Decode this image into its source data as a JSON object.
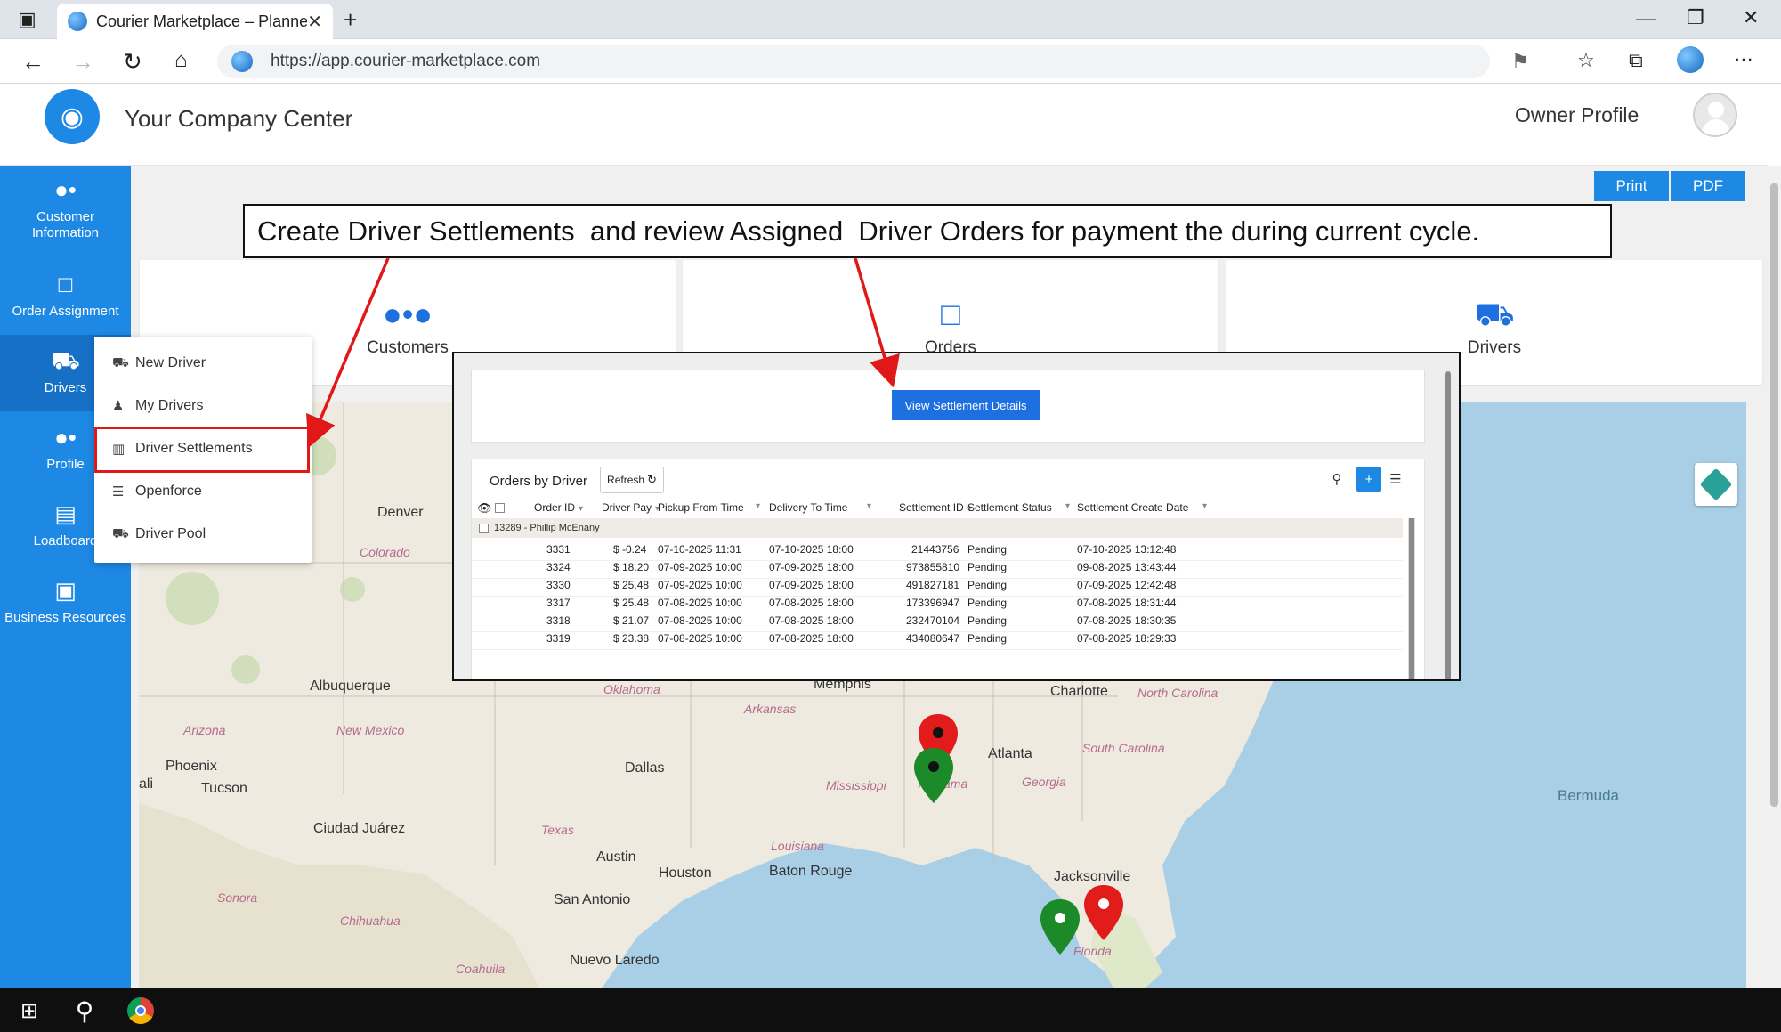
{
  "browser": {
    "tab_title": "Courier Marketplace – Planner",
    "url": "https://app.courier-marketplace.com"
  },
  "header": {
    "company": "Your Company Center",
    "owner": "Owner Profile"
  },
  "sidebar": {
    "items": [
      {
        "label": "Customer Information",
        "icon": "users-icon"
      },
      {
        "label": "Order Assignment",
        "icon": "monitor-icon"
      },
      {
        "label": "Drivers",
        "icon": "car-icon"
      },
      {
        "label": "Profile",
        "icon": "users-icon"
      },
      {
        "label": "Loadboard",
        "icon": "board-icon"
      },
      {
        "label": "Business Resources",
        "icon": "laptop-lock-icon"
      }
    ]
  },
  "toolbar": {
    "print_label": "Print",
    "pdf_label": "PDF"
  },
  "cards": [
    {
      "label": "Customers",
      "icon": "users-icon"
    },
    {
      "label": "Orders",
      "icon": "monitor-icon"
    },
    {
      "label": "Drivers",
      "icon": "car-icon"
    }
  ],
  "dropdown": {
    "items": [
      {
        "label": "New Driver",
        "icon": "car-icon"
      },
      {
        "label": "My Drivers",
        "icon": "people-icon"
      },
      {
        "label": "Driver Settlements",
        "icon": "bank-icon"
      },
      {
        "label": "Openforce",
        "icon": "document-icon"
      },
      {
        "label": "Driver Pool",
        "icon": "truck-icon"
      }
    ]
  },
  "callout": {
    "text": "Create Driver Settlements  and review Assigned  Driver Orders for payment the during current cycle."
  },
  "inset": {
    "view_button": "View Settlement Details",
    "table_title": "Orders by Driver",
    "refresh_label": "Refresh",
    "headers": [
      "Order ID",
      "Driver Pay",
      "Pickup From Time",
      "Delivery To Time",
      "Settlement ID",
      "Settlement Status",
      "Settlement Create Date"
    ],
    "group_label": "13289 - Phillip McEnany",
    "rows": [
      {
        "order_id": "3331",
        "pay": "$ -0.24",
        "pickup": "07-10-2025 11:31",
        "delivery": "07-10-2025 18:00",
        "settlement_id": "21443756",
        "status": "Pending",
        "created": "07-10-2025 13:12:48"
      },
      {
        "order_id": "3324",
        "pay": "$ 18.20",
        "pickup": "07-09-2025 10:00",
        "delivery": "07-09-2025 18:00",
        "settlement_id": "973855810",
        "status": "Pending",
        "created": "09-08-2025 13:43:44"
      },
      {
        "order_id": "3330",
        "pay": "$ 25.48",
        "pickup": "07-09-2025 10:00",
        "delivery": "07-09-2025 18:00",
        "settlement_id": "491827181",
        "status": "Pending",
        "created": "07-09-2025 12:42:48"
      },
      {
        "order_id": "3317",
        "pay": "$ 25.48",
        "pickup": "07-08-2025 10:00",
        "delivery": "07-08-2025 18:00",
        "settlement_id": "173396947",
        "status": "Pending",
        "created": "07-08-2025 18:31:44"
      },
      {
        "order_id": "3318",
        "pay": "$ 21.07",
        "pickup": "07-08-2025 10:00",
        "delivery": "07-08-2025 18:00",
        "settlement_id": "232470104",
        "status": "Pending",
        "created": "07-08-2025 18:30:35"
      },
      {
        "order_id": "3319",
        "pay": "$ 23.38",
        "pickup": "07-08-2025 10:00",
        "delivery": "07-08-2025 18:00",
        "settlement_id": "434080647",
        "status": "Pending",
        "created": "07-08-2025 18:29:33"
      }
    ]
  },
  "map_labels": {
    "denver": "Denver",
    "colorado": "Colorado",
    "albuquerque": "Albuquerque",
    "arizona": "Arizona",
    "new_mexico": "New Mexico",
    "phoenix": "Phoenix",
    "tucson": "Tucson",
    "ali": "ali",
    "ciudad_juarez": "Ciudad Juárez",
    "sonora": "Sonora",
    "chihuahua": "Chihuahua",
    "coahuila": "Coahuila",
    "oklahoma": "Oklahoma",
    "memphis": "Memphis",
    "arkansas": "Arkansas",
    "dallas": "Dallas",
    "texas": "Texas",
    "austin": "Austin",
    "houston": "Houston",
    "san_antonio": "San Antonio",
    "nuevo_laredo": "Nuevo Laredo",
    "mississippi": "Mississippi",
    "louisiana": "Louisiana",
    "baton_rouge": "Baton Rouge",
    "alabama": "Alabama",
    "atlanta": "Atlanta",
    "georgia": "Georgia",
    "charlotte": "Charlotte",
    "north_carolina": "North Carolina",
    "south_carolina": "South Carolina",
    "jacksonville": "Jacksonville",
    "florida": "Florida",
    "bermuda": "Bermuda"
  },
  "colors": {
    "accent": "#1e88e5",
    "highlight": "#e01818",
    "pin_red": "#e21b1b",
    "pin_green": "#1d8a2a"
  }
}
